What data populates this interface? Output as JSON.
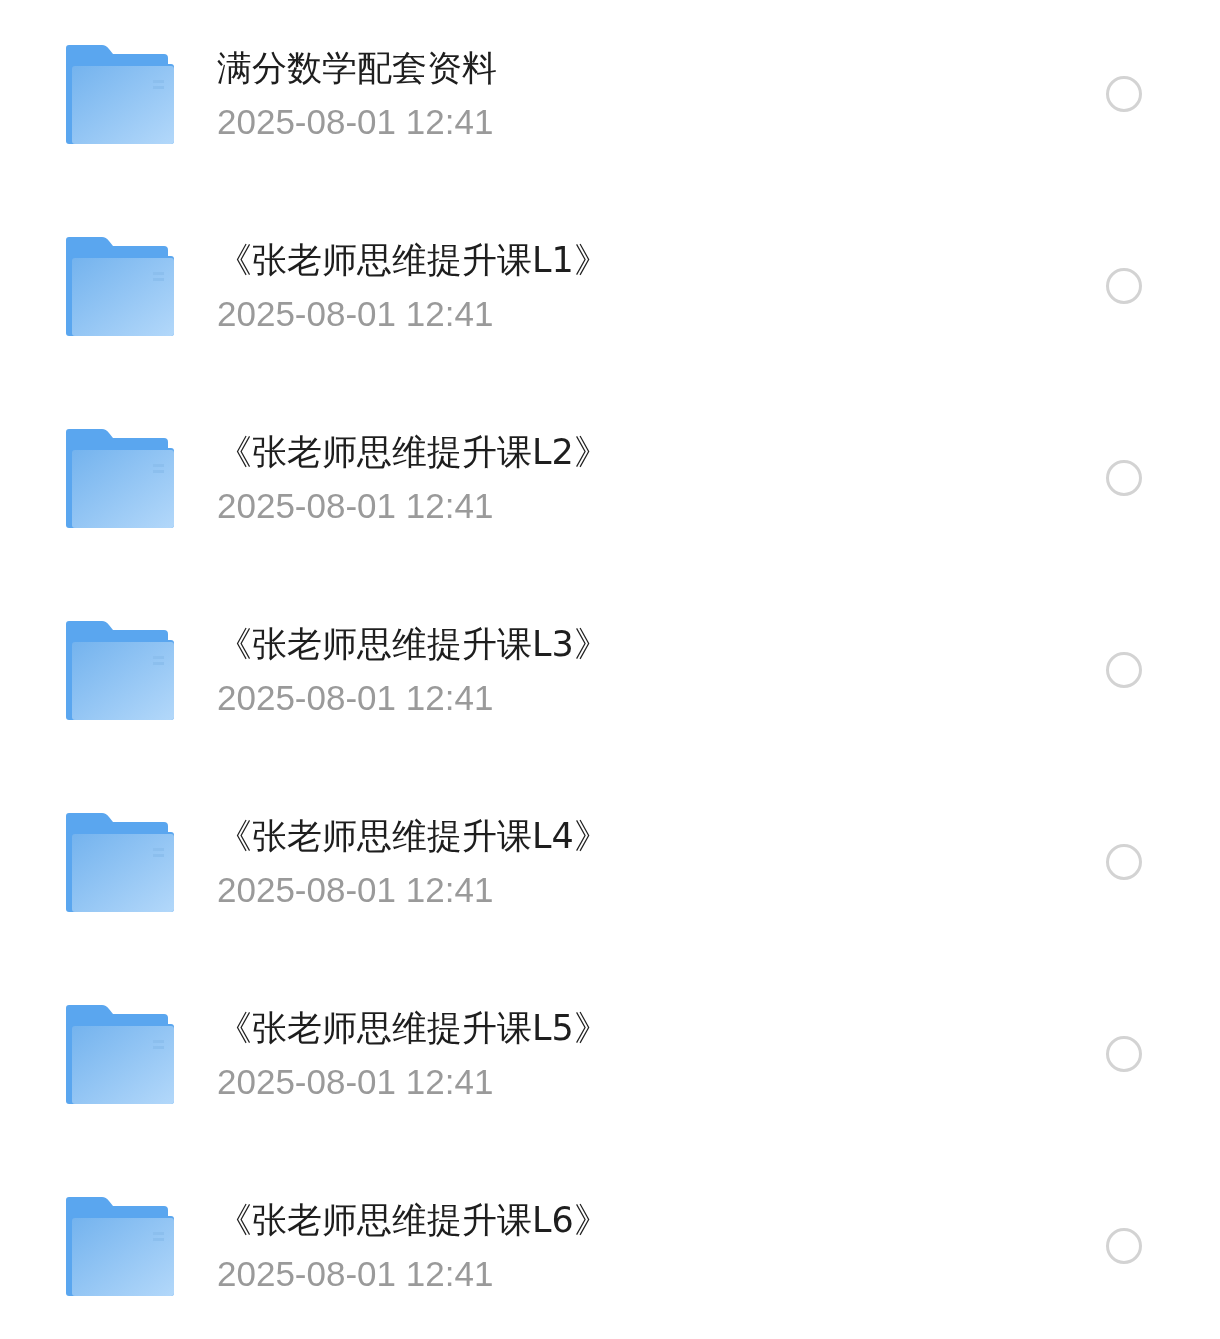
{
  "files": [
    {
      "name": "满分数学配套资料",
      "date": "2025-08-01 12:41",
      "selected": false
    },
    {
      "name": "《张老师思维提升课L1》",
      "date": "2025-08-01 12:41",
      "selected": false
    },
    {
      "name": "《张老师思维提升课L2》",
      "date": "2025-08-01 12:41",
      "selected": false
    },
    {
      "name": "《张老师思维提升课L3》",
      "date": "2025-08-01 12:41",
      "selected": false
    },
    {
      "name": "《张老师思维提升课L4》",
      "date": "2025-08-01 12:41",
      "selected": false
    },
    {
      "name": "《张老师思维提升课L5》",
      "date": "2025-08-01 12:41",
      "selected": false
    },
    {
      "name": "《张老师思维提升课L6》",
      "date": "2025-08-01 12:41",
      "selected": false
    }
  ]
}
